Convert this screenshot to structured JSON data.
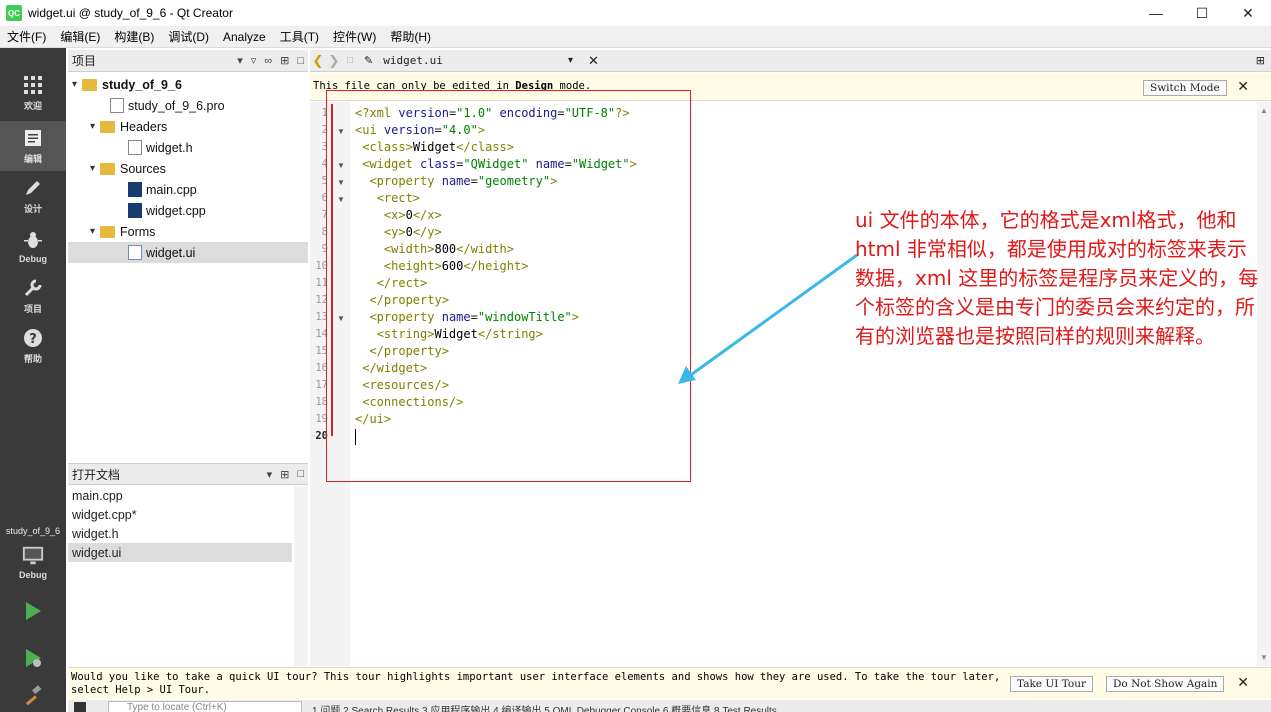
{
  "window": {
    "title": "widget.ui @ study_of_9_6 - Qt Creator",
    "logo": "QC"
  },
  "menu": [
    "文件(F)",
    "编辑(E)",
    "构建(B)",
    "调试(D)",
    "Analyze",
    "工具(T)",
    "控件(W)",
    "帮助(H)"
  ],
  "modes": [
    {
      "label": "欢迎",
      "icon": "grid-icon"
    },
    {
      "label": "编辑",
      "icon": "edit-icon"
    },
    {
      "label": "设计",
      "icon": "pen-icon"
    },
    {
      "label": "Debug",
      "icon": "bug-icon"
    },
    {
      "label": "项目",
      "icon": "wrench-icon"
    },
    {
      "label": "帮助",
      "icon": "help-icon"
    }
  ],
  "kit": {
    "project": "study_of_9_6",
    "mode": "Debug"
  },
  "project_panel": {
    "title": "项目",
    "tree": [
      {
        "label": "study_of_9_6",
        "type": "project"
      },
      {
        "label": "study_of_9_6.pro",
        "type": "pro"
      },
      {
        "label": "Headers",
        "type": "folder"
      },
      {
        "label": "widget.h",
        "type": "file"
      },
      {
        "label": "Sources",
        "type": "folder"
      },
      {
        "label": "main.cpp",
        "type": "cpp"
      },
      {
        "label": "widget.cpp",
        "type": "cpp"
      },
      {
        "label": "Forms",
        "type": "folder"
      },
      {
        "label": "widget.ui",
        "type": "ui"
      }
    ]
  },
  "open_docs": {
    "title": "打开文档",
    "items": [
      "main.cpp",
      "widget.cpp*",
      "widget.h",
      "widget.ui"
    ]
  },
  "editor": {
    "filename": "widget.ui",
    "info_prefix": "This file can only be edited in ",
    "info_bold": "Design",
    "info_suffix": " mode.",
    "switch_mode": "Switch Mode",
    "line_numbers": [
      "1",
      "2",
      "3",
      "4",
      "5",
      "6",
      "7",
      "8",
      "9",
      "10",
      "11",
      "12",
      "13",
      "14",
      "15",
      "16",
      "17",
      "18",
      "19",
      "20"
    ]
  },
  "annotation": {
    "text": "ui 文件的本体，它的格式是xml格式，他和html 非常相似，都是使用成对的标签来表示数据，xml 这里的标签是程序员来定义的，每个标签的含义是由专门的委员会来约定的，所有的浏览器也是按照同样的规则来解释。"
  },
  "tour": {
    "message": "Would you like to take a quick UI tour? This tour highlights important user interface elements and shows how they are used. To take the tour later, select Help > UI Tour.",
    "take": "Take UI Tour",
    "dismiss": "Do Not Show Again"
  },
  "status": {
    "locator_placeholder": "Type to locate (Ctrl+K)",
    "tabs": "1 问题   2 Search Results   3 应用程序输出   4 编译输出   5 QML Debugger Console   6 概要信息   8 Test Results"
  },
  "colors": {
    "modebar": "#3a3a3a",
    "annotation": "#e01818",
    "arrow": "#3ab8ea"
  }
}
